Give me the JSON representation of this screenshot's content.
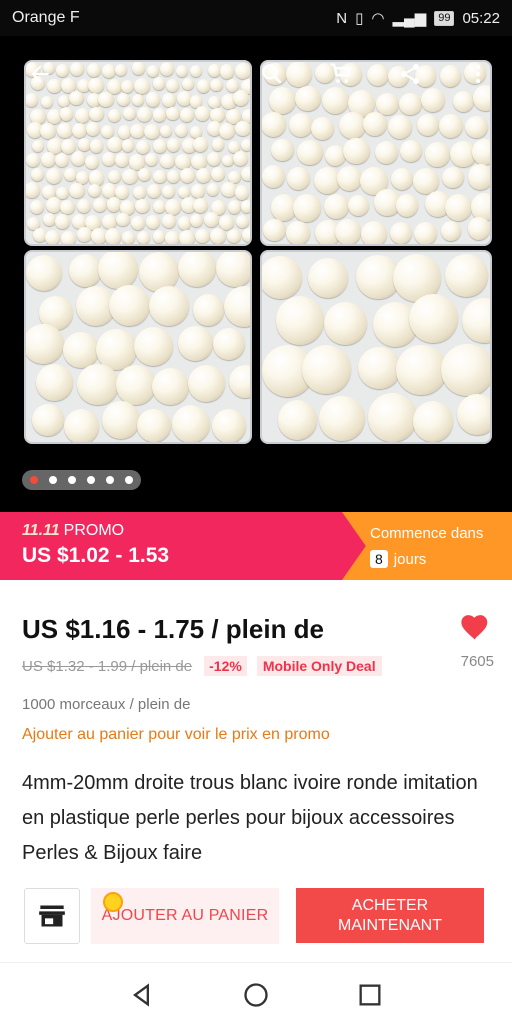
{
  "status_bar": {
    "carrier": "Orange F",
    "battery": "99",
    "time": "05:22"
  },
  "gallery": {
    "image_count": 6,
    "active_index": 0
  },
  "promo": {
    "event": "11.11",
    "label": "PROMO",
    "price_range": "US $1.02 - 1.53",
    "starts_label": "Commence dans",
    "days_value": "8",
    "days_unit": "jours"
  },
  "product": {
    "price": "US $1.16 - 1.75 / plein de",
    "old_price": "US $1.32 - 1.99 / plein de",
    "discount": "-12%",
    "deal_badge": "Mobile Only Deal",
    "wishlist_count": "7605",
    "lot_size": "1000 morceaux / plein de",
    "promo_hint": "Ajouter au panier pour voir le prix en promo",
    "title": "4mm-20mm droite trous blanc ivoire ronde imitation en plastique perle perles pour bijoux accessoires Perles & Bijoux faire"
  },
  "actions": {
    "add_to_cart": "AJOUTER AU PANIER",
    "buy_now_line1": "ACHETER",
    "buy_now_line2": "MAINTENANT"
  },
  "colors": {
    "promo_pink": "#f2275e",
    "promo_orange": "#ff9726",
    "accent_red": "#f24949",
    "hint_orange": "#e87a14"
  },
  "icons": [
    "back-arrow-icon",
    "search-icon",
    "cart-icon",
    "share-icon",
    "more-vert-icon",
    "heart-icon",
    "store-icon",
    "nav-back-icon",
    "nav-home-icon",
    "nav-recents-icon"
  ]
}
